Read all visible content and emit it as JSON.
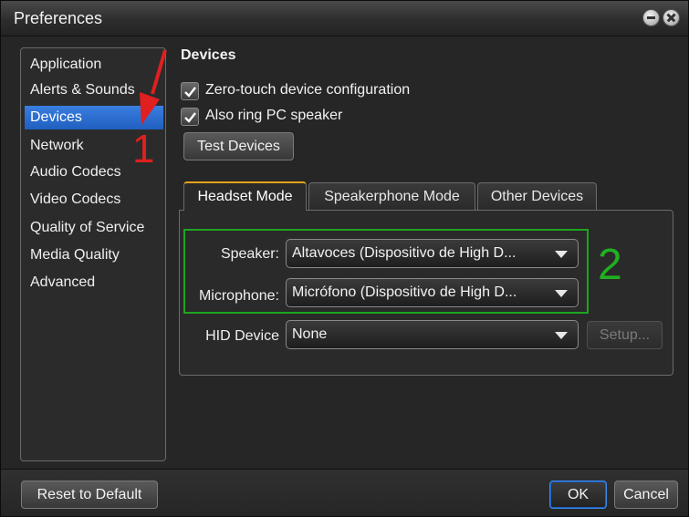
{
  "window": {
    "title": "Preferences"
  },
  "sidebar": {
    "items": [
      {
        "label": "Application",
        "selected": false
      },
      {
        "label": "Alerts & Sounds",
        "selected": false
      },
      {
        "label": "Devices",
        "selected": true
      },
      {
        "label": "Network",
        "selected": false
      },
      {
        "label": "Audio Codecs",
        "selected": false
      },
      {
        "label": "Video Codecs",
        "selected": false
      },
      {
        "label": "Quality of Service",
        "selected": false
      },
      {
        "label": "Media Quality",
        "selected": false
      },
      {
        "label": "Advanced",
        "selected": false
      }
    ]
  },
  "devices": {
    "title": "Devices",
    "zero_touch": {
      "label": "Zero-touch device configuration",
      "checked": true
    },
    "ring_pc": {
      "label": "Also ring PC speaker",
      "checked": true
    },
    "test_button": "Test Devices",
    "tabs": [
      {
        "label": "Headset Mode",
        "active": true
      },
      {
        "label": "Speakerphone Mode",
        "active": false
      },
      {
        "label": "Other Devices",
        "active": false
      }
    ],
    "speaker": {
      "label": "Speaker:",
      "value": "Altavoces (Dispositivo de High D..."
    },
    "microphone": {
      "label": "Microphone:",
      "value": "Micrófono (Dispositivo de High D..."
    },
    "hid": {
      "label": "HID Device",
      "value": "None",
      "setup_label": "Setup..."
    }
  },
  "annotations": {
    "step1": "1",
    "step2": "2"
  },
  "footer": {
    "reset_label": "Reset to Default",
    "ok_label": "OK",
    "cancel_label": "Cancel"
  },
  "colors": {
    "selection": "#2a6fd6",
    "annotation_red": "#e01f1f",
    "annotation_green": "#20b020",
    "active_tab_accent": "#e6a21a"
  }
}
